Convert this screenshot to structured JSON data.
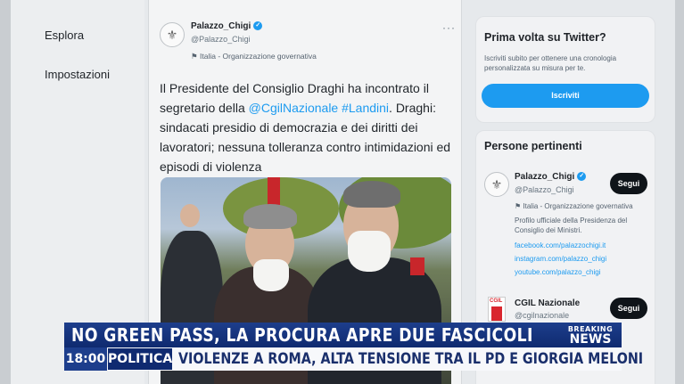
{
  "nav": {
    "items": [
      {
        "label": "Esplora"
      },
      {
        "label": "Impostazioni"
      }
    ]
  },
  "tweet": {
    "author_name": "Palazzo_Chigi",
    "author_handle": "@Palazzo_Chigi",
    "author_label": "Italia - Organizzazione governativa",
    "more_label": "···",
    "text_part1": "Il Presidente del Consiglio Draghi ha incontrato il segretario della ",
    "link1": "@CgilNazionale",
    "link2": "#Landini",
    "text_part2": ". Draghi: sindacati presidio di democrazia e dei diritti dei lavoratori; nessuna tolleranza contro intimidazioni ed episodi di violenza"
  },
  "sidebar": {
    "signup": {
      "title": "Prima volta su Twitter?",
      "description": "Iscriviti subito per ottenere una cronologia personalizzata su misura per te.",
      "button": "Iscriviti"
    },
    "relevant": {
      "title": "Persone pertinenti",
      "people": [
        {
          "name": "Palazzo_Chigi",
          "handle": "@Palazzo_Chigi",
          "follow": "Segui",
          "label": "Italia - Organizzazione governativa",
          "bio": "Profilo ufficiale della Presidenza del Consiglio dei Ministri.",
          "links": [
            "facebook.com/palazzochigi.it",
            "instagram.com/palazzo_chigi",
            "youtube.com/palazzo_chigi"
          ]
        },
        {
          "name": "CGIL Nazionale",
          "handle": "@cgilnazionale",
          "follow": "Segui",
          "logo_text": "CGIL"
        }
      ]
    }
  },
  "ticker": {
    "headline": "NO GREEN PASS, LA PROCURA APRE DUE FASCICOLI",
    "breaking_line1": "BREAKING",
    "breaking_line2": "NEWS",
    "time": "18:00",
    "category": "POLITICA",
    "subline": "VIOLENZE A ROMA, ALTA TENSIONE TRA IL PD E GIORGIA MELONI"
  },
  "colors": {
    "twitter_blue": "#1d9bf0",
    "ticker_blue": "#1d3e8c",
    "ticker_dark": "#0f2a70"
  }
}
